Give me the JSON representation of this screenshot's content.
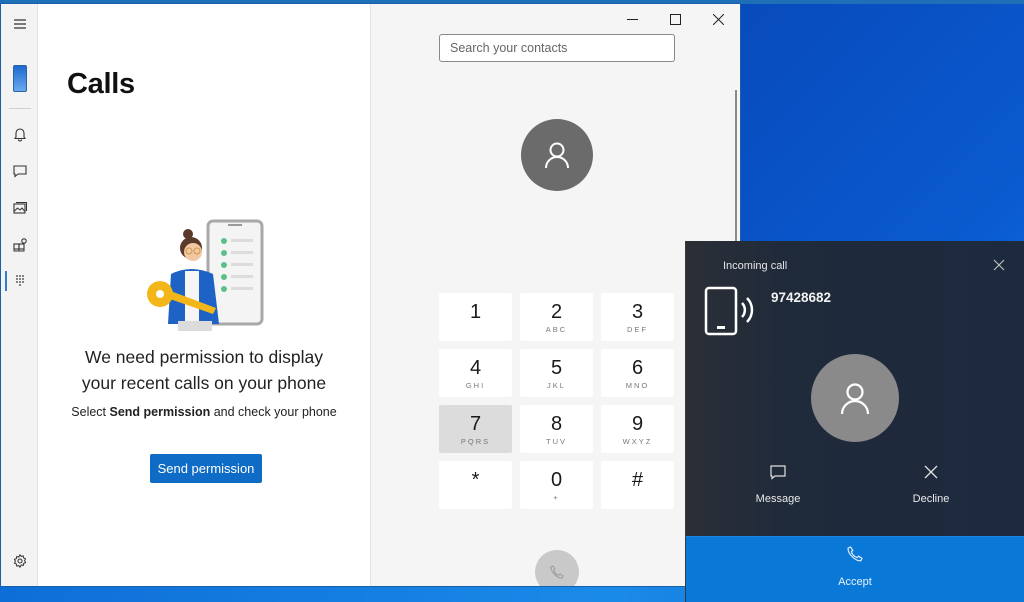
{
  "window": {
    "title": "Calls",
    "controls": {
      "minimize": "minimize",
      "maximize": "maximize",
      "close": "close"
    }
  },
  "nav_rail": {
    "items": [
      {
        "name": "menu",
        "icon": "hamburger-icon"
      },
      {
        "name": "phone",
        "icon": "phone-thumbnail-icon"
      },
      {
        "name": "notifications",
        "icon": "bell-icon"
      },
      {
        "name": "messages",
        "icon": "chat-icon"
      },
      {
        "name": "photos",
        "icon": "photos-icon"
      },
      {
        "name": "apps",
        "icon": "apps-icon"
      },
      {
        "name": "calls",
        "icon": "dialpad-icon",
        "active": true
      },
      {
        "name": "settings",
        "icon": "gear-icon"
      }
    ]
  },
  "left_pane": {
    "heading_line1": "We need permission to display",
    "heading_line2": "your recent calls on your phone",
    "sub_prefix": "Select ",
    "sub_bold": "Send permission",
    "sub_suffix": " and check your phone",
    "send_button": "Send permission"
  },
  "right_pane": {
    "search_placeholder": "Search your contacts",
    "dialpad": [
      {
        "digit": "1",
        "letters": ""
      },
      {
        "digit": "2",
        "letters": "ABC"
      },
      {
        "digit": "3",
        "letters": "DEF"
      },
      {
        "digit": "4",
        "letters": "GHI"
      },
      {
        "digit": "5",
        "letters": "JKL"
      },
      {
        "digit": "6",
        "letters": "MNO"
      },
      {
        "digit": "7",
        "letters": "PQRS",
        "pressed": true
      },
      {
        "digit": "8",
        "letters": "TUV"
      },
      {
        "digit": "9",
        "letters": "WXYZ"
      },
      {
        "digit": "*",
        "letters": ""
      },
      {
        "digit": "0",
        "letters": "+"
      },
      {
        "digit": "#",
        "letters": ""
      }
    ]
  },
  "incoming_call": {
    "title": "Incoming call",
    "number": "97428682",
    "message_label": "Message",
    "decline_label": "Decline",
    "accept_label": "Accept",
    "accent_color": "#0a78d7"
  }
}
